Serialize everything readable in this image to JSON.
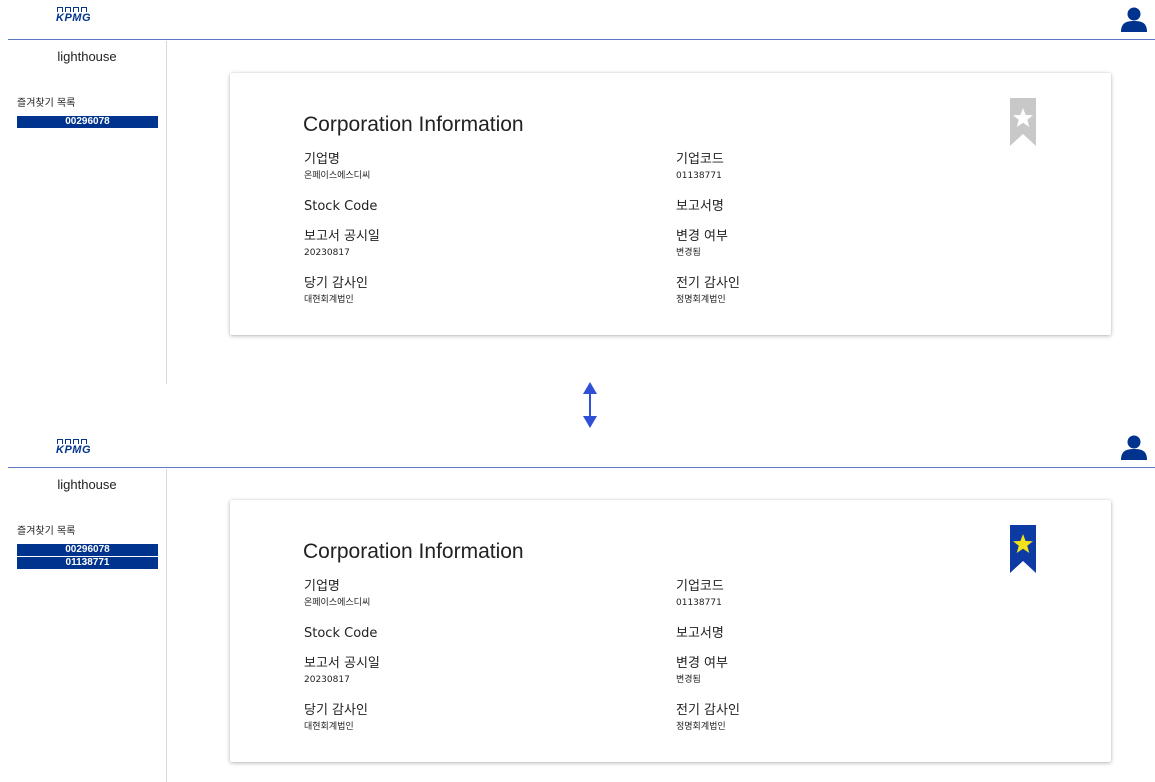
{
  "header": {
    "logo_text": "KPMG"
  },
  "sidebar": {
    "brand": "lighthouse",
    "favorites_title": "즐겨찾기 목록"
  },
  "top": {
    "favorites": [
      "00296078"
    ],
    "bookmarked": false
  },
  "bottom": {
    "favorites": [
      "00296078",
      "01138771"
    ],
    "bookmarked": true
  },
  "card": {
    "title": "Corporation Information",
    "fields": {
      "company_name": {
        "label": "기업명",
        "value": "온페이스에스디씨"
      },
      "company_code": {
        "label": "기업코드",
        "value": "01138771"
      },
      "stock_code": {
        "label": "Stock Code",
        "value": ""
      },
      "report_name": {
        "label": "보고서명",
        "value": ""
      },
      "report_date": {
        "label": "보고서 공시일",
        "value": "20230817"
      },
      "changed": {
        "label": "변경 여부",
        "value": "변경됨"
      },
      "current_auditor": {
        "label": "당기 감사인",
        "value": "대현회계법인"
      },
      "previous_auditor": {
        "label": "전기 감사인",
        "value": "정명회계법인"
      }
    }
  },
  "icons": {
    "user": "user-icon",
    "bookmark_off": "bookmark-icon",
    "bookmark_on": "bookmark-filled-icon",
    "arrow": "double-arrow-icon"
  },
  "colors": {
    "brand_blue": "#00338d",
    "header_line": "#5a77c8",
    "bookmark_off": "#c8c8c8",
    "star_on": "#f2e21a",
    "arrow": "#2f4fd6"
  }
}
